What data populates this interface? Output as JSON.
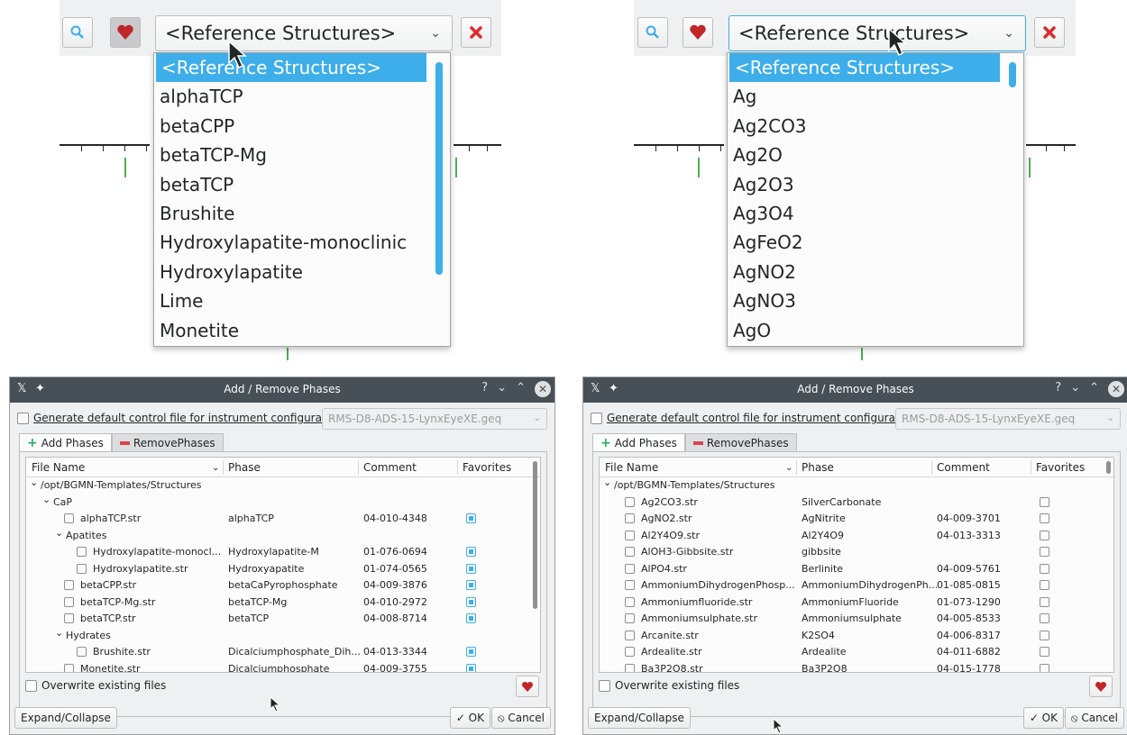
{
  "left_combo": {
    "selected": "<Reference Structures>",
    "items": [
      "<Reference Structures>",
      "alphaTCP",
      "betaCPP",
      "betaTCP-Mg",
      "betaTCP",
      "Brushite",
      "Hydroxylapatite-monoclinic",
      "Hydroxylapatite",
      "Lime",
      "Monetite"
    ]
  },
  "right_combo": {
    "selected": "<Reference Structures>",
    "items": [
      "<Reference Structures>",
      "Ag",
      "Ag2CO3",
      "Ag2O",
      "Ag2O3",
      "Ag3O4",
      "AgFeO2",
      "AgNO2",
      "AgNO3",
      "AgO"
    ]
  },
  "dialog": {
    "title": "Add / Remove Phases",
    "title_help": "?",
    "generate_label": "Generate default control file for instrument configuration:",
    "instrument_value": "RMS-D8-ADS-15-LynxEyeXE.geq",
    "tab_add": "Add Phases",
    "tab_remove": "RemovePhases",
    "columns": {
      "file": "File Name",
      "phase": "Phase",
      "comment": "Comment",
      "favorites": "Favorites"
    },
    "overwrite_label": "Overwrite existing files",
    "expand_label": "Expand/Collapse",
    "ok_label": "✓ OK",
    "cancel_label": "⦸ Cancel"
  },
  "left_tree": [
    {
      "file": "/opt/BGMN-Templates/Structures",
      "phase": "",
      "comment": "",
      "level": 0,
      "folder": true
    },
    {
      "file": "CaP",
      "phase": "",
      "comment": "",
      "level": 1,
      "folder": true
    },
    {
      "file": "alphaTCP.str",
      "phase": "alphaTCP",
      "comment": "04-010-4348",
      "level": 2,
      "fav": true
    },
    {
      "file": "Apatites",
      "phase": "",
      "comment": "",
      "level": 2,
      "folder": true
    },
    {
      "file": "Hydroxylapatite-monocl...",
      "phase": "Hydroxylapatite-M",
      "comment": "01-076-0694",
      "level": 3,
      "fav": true
    },
    {
      "file": "Hydroxylapatite.str",
      "phase": "Hydroxyapatite",
      "comment": "01-074-0565",
      "level": 3,
      "fav": true
    },
    {
      "file": "betaCPP.str",
      "phase": "betaCaPyrophosphate",
      "comment": "04-009-3876",
      "level": 2,
      "fav": true
    },
    {
      "file": "betaTCP-Mg.str",
      "phase": "betaTCP-Mg",
      "comment": "04-010-2972",
      "level": 2,
      "fav": true
    },
    {
      "file": "betaTCP.str",
      "phase": "betaTCP",
      "comment": "04-008-8714",
      "level": 2,
      "fav": true
    },
    {
      "file": "Hydrates",
      "phase": "",
      "comment": "",
      "level": 2,
      "folder": true
    },
    {
      "file": "Brushite.str",
      "phase": "Dicalciumphosphate_Dih...",
      "comment": "04-013-3344",
      "level": 3,
      "fav": true
    },
    {
      "file": "Monetite.str",
      "phase": "Dicalciumphosphate",
      "comment": "04-009-3755",
      "level": 2,
      "fav": true
    }
  ],
  "right_tree": [
    {
      "file": "/opt/BGMN-Templates/Structures",
      "phase": "",
      "comment": "",
      "level": 0,
      "folder": true
    },
    {
      "file": "Ag2CO3.str",
      "phase": "SilverCarbonate",
      "comment": "",
      "level": 1,
      "fav": false
    },
    {
      "file": "AgNO2.str",
      "phase": "AgNitrite",
      "comment": "04-009-3701",
      "level": 1,
      "fav": false
    },
    {
      "file": "Al2Y4O9.str",
      "phase": "Al2Y4O9",
      "comment": "04-013-3313",
      "level": 1,
      "fav": false
    },
    {
      "file": "AlOH3-Gibbsite.str",
      "phase": "gibbsite",
      "comment": "",
      "level": 1,
      "fav": false
    },
    {
      "file": "AlPO4.str",
      "phase": "Berlinite",
      "comment": "04-009-5761",
      "level": 1,
      "fav": false
    },
    {
      "file": "AmmoniumDihydrogenPhosp...",
      "phase": "AmmoniumDihydrogenPh...",
      "comment": "01-085-0815",
      "level": 1,
      "fav": false
    },
    {
      "file": "Ammoniumfluoride.str",
      "phase": "AmmoniumFluoride",
      "comment": "01-073-1290",
      "level": 1,
      "fav": false
    },
    {
      "file": "Ammoniumsulphate.str",
      "phase": "Ammoniumsulphate",
      "comment": "04-005-8533",
      "level": 1,
      "fav": false
    },
    {
      "file": "Arcanite.str",
      "phase": "K2SO4",
      "comment": "04-006-8317",
      "level": 1,
      "fav": false
    },
    {
      "file": "Ardealite.str",
      "phase": "Ardealite",
      "comment": "04-011-6882",
      "level": 1,
      "fav": false
    },
    {
      "file": "Ba3P2O8.str",
      "phase": "Ba3P2O8",
      "comment": "04-015-1778",
      "level": 1,
      "fav": false
    }
  ],
  "colors": {
    "accent": "#3daee9",
    "titlebar": "#475057",
    "favorite_heart": "#c0262a"
  },
  "icons": [
    "search-icon",
    "heart-icon",
    "close-icon",
    "chevron-down-icon",
    "pin-icon",
    "app-icon"
  ]
}
